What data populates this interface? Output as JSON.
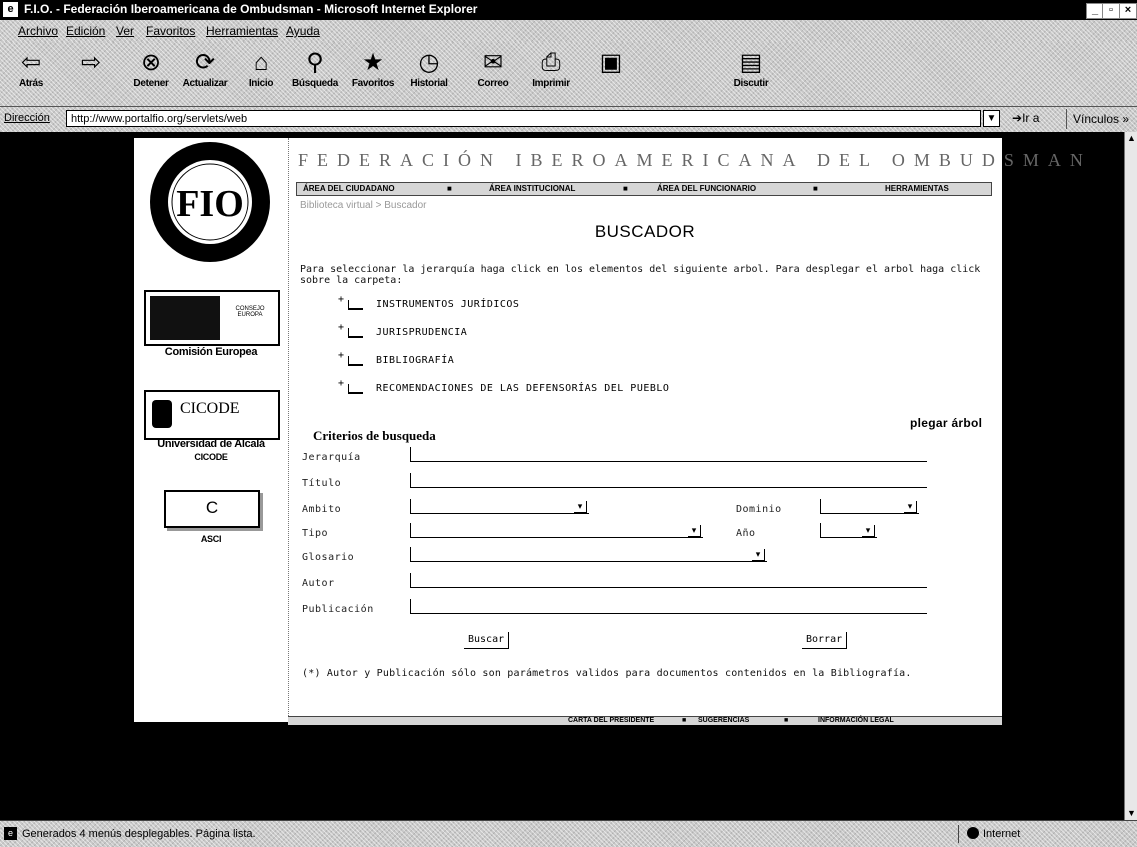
{
  "window": {
    "title": "F.I.O. - Federación Iberoamericana de Ombudsman - Microsoft Internet Explorer",
    "app_icon": "ie-icon",
    "controls": [
      "minimize",
      "maximize",
      "close"
    ]
  },
  "menu": [
    "Archivo",
    "Edición",
    "Ver",
    "Favoritos",
    "Herramientas",
    "Ayuda"
  ],
  "toolbar": [
    {
      "label": "Atrás",
      "icon": "back-arrow"
    },
    {
      "label": "",
      "icon": "forward-arrow"
    },
    {
      "label": "Detener",
      "icon": "stop"
    },
    {
      "label": "Actualizar",
      "icon": "refresh"
    },
    {
      "label": "Inicio",
      "icon": "home"
    },
    {
      "label": "Búsqueda",
      "icon": "search"
    },
    {
      "label": "Favoritos",
      "icon": "favorites"
    },
    {
      "label": "Historial",
      "icon": "history"
    },
    {
      "label": "Correo",
      "icon": "mail"
    },
    {
      "label": "Imprimir",
      "icon": "print"
    },
    {
      "label": "",
      "icon": "edit"
    },
    {
      "label": "Discutir",
      "icon": "discuss"
    }
  ],
  "address": {
    "label": "Dirección",
    "url": "http://www.portalfio.org/servlets/web",
    "go": "Ir a",
    "links": "Vínculos »"
  },
  "page": {
    "logo_text": "FIO",
    "banner": "FEDERACIÓN IBEROAMERICANA DEL OMBUDSMAN",
    "nav": [
      "ÁREA DEL CIUDADANO",
      "ÁREA INSTITUCIONAL",
      "ÁREA DEL FUNCIONARIO",
      "HERRAMIENTAS"
    ],
    "nav_sep": "■",
    "breadcrumb": "Biblioteca virtual > Buscador",
    "title": "BUSCADOR",
    "instructions": "Para seleccionar la jerarquía haga click en los elementos del siguiente arbol. Para desplegar el arbol haga click sobre la carpeta:",
    "tree": [
      {
        "marker": "+",
        "label": "INSTRUMENTOS JURÍDICOS"
      },
      {
        "marker": "+",
        "label": "JURISPRUDENCIA"
      },
      {
        "marker": "+",
        "label": "BIBLIOGRAFÍA"
      },
      {
        "marker": "+",
        "label": "RECOMENDACIONES DE LAS DEFENSORÍAS DEL PUEBLO"
      }
    ],
    "fold_tree": "plegar árbol",
    "criteria_title": "Criterios de busqueda",
    "fields": {
      "jerarquia": "Jerarquía",
      "titulo": "Título",
      "ambito": "Ambito",
      "dominio": "Dominio",
      "tipo": "Tipo",
      "anio": "Año",
      "glosario": "Glosario",
      "autor": "Autor",
      "publicacion": "Publicación"
    },
    "buttons": {
      "search": "Buscar",
      "clear": "Borrar"
    },
    "note": "(*) Autor y Publicación sólo son parámetros validos para documentos contenidos en la Bibliografía.",
    "footer": [
      "CARTA DEL PRESIDENTE",
      "SUGERENCIAS",
      "INFORMACIÓN LEGAL"
    ],
    "sidebar": {
      "eu_caption": "Comisión Europea",
      "eu_box": "CONSEJO EUROPA",
      "cicode_box": "CICODE",
      "cicode_caption": "Universidad de Alcalá",
      "cicode_sub": "CICODE",
      "asci_box": "C",
      "asci_caption": "ASCI"
    }
  },
  "status": {
    "text": "Generados 4 menús desplegables. Página lista.",
    "zone": "Internet"
  }
}
